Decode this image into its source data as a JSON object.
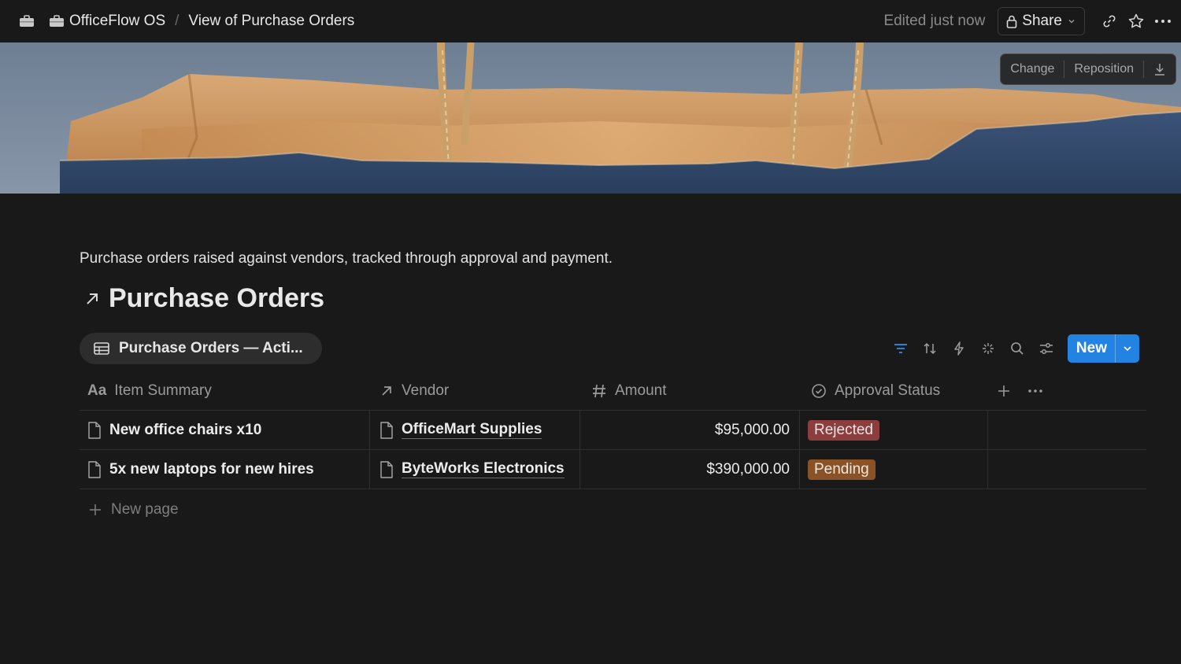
{
  "breadcrumb": {
    "workspace": "OfficeFlow OS",
    "page": "View of Purchase Orders"
  },
  "topbar": {
    "edited": "Edited just now",
    "share_label": "Share"
  },
  "cover": {
    "change_label": "Change",
    "reposition_label": "Reposition"
  },
  "page": {
    "description": "Purchase orders raised against vendors, tracked through approval and payment.",
    "title": "Purchase Orders"
  },
  "view": {
    "tab_label": "Purchase Orders — Acti...",
    "new_label": "New"
  },
  "table": {
    "columns": [
      {
        "label": "Item Summary",
        "icon": "aa-text-icon"
      },
      {
        "label": "Vendor",
        "icon": "relation-arrow-icon"
      },
      {
        "label": "Amount",
        "icon": "hash-icon"
      },
      {
        "label": "Approval Status",
        "icon": "status-icon"
      }
    ],
    "rows": [
      {
        "item": "New office chairs x10",
        "vendor": "OfficeMart Supplies",
        "amount": "$95,000.00",
        "status": "Rejected",
        "status_color": "#8c3d3d"
      },
      {
        "item": "5x new laptops for new hires",
        "vendor": "ByteWorks Electronics",
        "amount": "$390,000.00",
        "status": "Pending",
        "status_color": "#8a5227"
      }
    ],
    "new_page_label": "New page"
  },
  "colors": {
    "background": "#191919",
    "accent_blue": "#2383e2"
  }
}
